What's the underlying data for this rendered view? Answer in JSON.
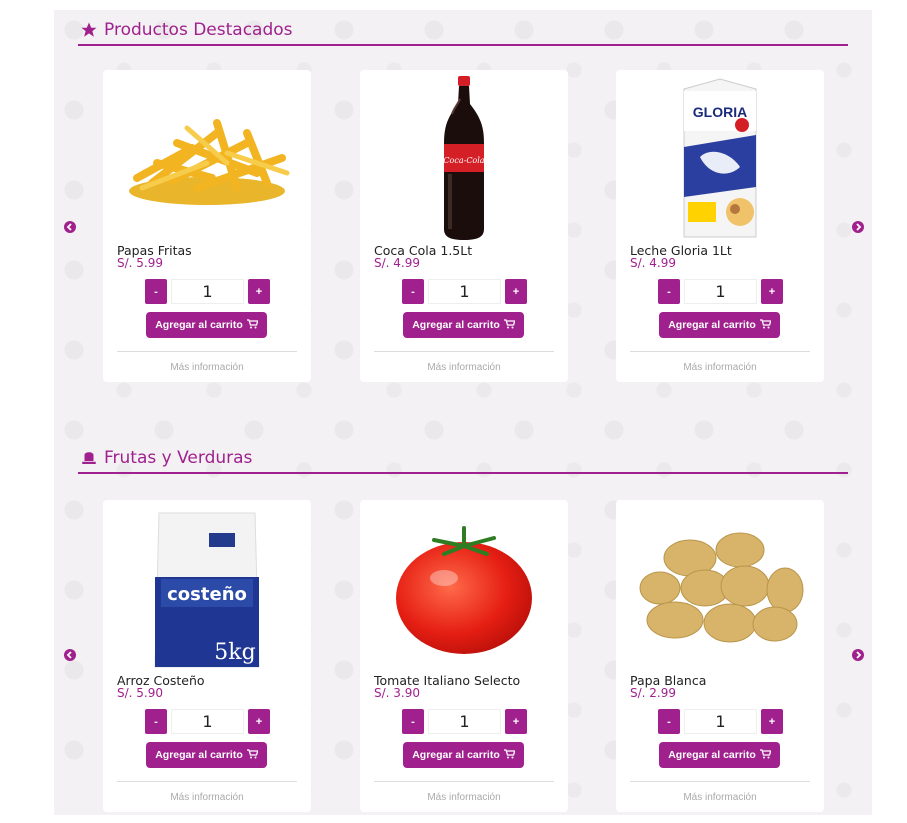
{
  "sections": [
    {
      "title": "Productos Destacados",
      "icon": "star-icon",
      "products": [
        {
          "name": "Papas Fritas",
          "price": "S/. 5.99",
          "qty": "1",
          "image": "fries-image"
        },
        {
          "name": "Coca Cola 1.5Lt",
          "price": "S/. 4.99",
          "qty": "1",
          "image": "cola-bottle-image"
        },
        {
          "name": "Leche Gloria 1Lt",
          "price": "S/. 4.99",
          "qty": "1",
          "image": "milk-carton-image"
        }
      ]
    },
    {
      "title": "Frutas y Verduras",
      "icon": "hat-icon",
      "products": [
        {
          "name": "Arroz Costeño",
          "price": "S/. 5.90",
          "qty": "1",
          "image": "rice-bag-image"
        },
        {
          "name": "Tomate Italiano Selecto",
          "price": "S/. 3.90",
          "qty": "1",
          "image": "tomato-image"
        },
        {
          "name": "Papa Blanca",
          "price": "S/. 2.99",
          "qty": "1",
          "image": "potatoes-image"
        }
      ]
    }
  ],
  "labels": {
    "minus": "-",
    "plus": "+",
    "add_to_cart": "Agregar al carrito",
    "more_info": "Más información"
  },
  "product_image_text": {
    "cola_label": "Coca-Cola",
    "milk_brand": "GLORIA",
    "rice_brand": "costeño",
    "rice_weight": "5kg"
  },
  "colors": {
    "accent": "#a0218d",
    "background": "#f3f1f3"
  }
}
